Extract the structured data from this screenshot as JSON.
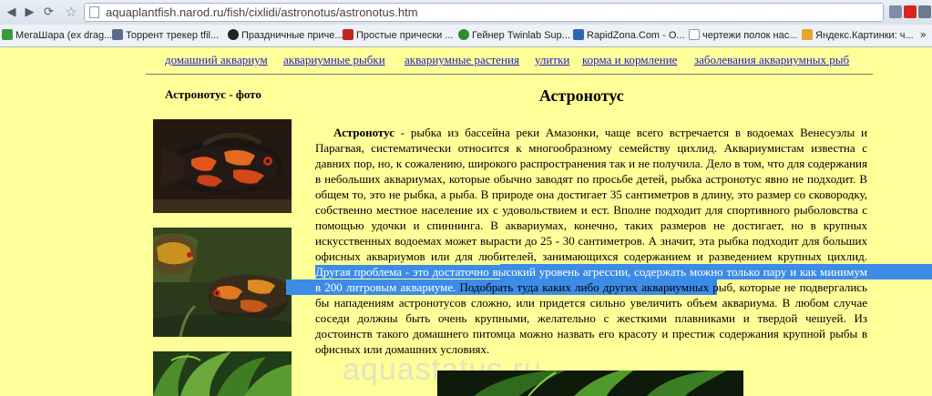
{
  "browser": {
    "back_glyph": "◀",
    "forward_glyph": "▶",
    "reload_glyph": "⟳",
    "star_glyph": "☆",
    "url": "aquaplantfish.narod.ru/fish/cixlidi/astronotus/astronotus.htm",
    "bookmarks": [
      {
        "label": "МегаШара (ex drag...",
        "icon": "green-check-icon",
        "color": "#3b9b3b"
      },
      {
        "label": "Торрент трекер tfil...",
        "icon": "tracker-icon",
        "color": "#5a6b8c"
      },
      {
        "label": "Праздничные приче...",
        "icon": "eye-icon",
        "color": "#222222"
      },
      {
        "label": "Простые прически ...",
        "icon": "news-icon",
        "color": "#c4261d"
      },
      {
        "label": "Гейнер Twinlab Sup...",
        "icon": "circle-icon",
        "color": "#2e8b2e"
      },
      {
        "label": "RapidZona.Com - О...",
        "icon": "pin-icon",
        "color": "#2f66b3"
      },
      {
        "label": "чертежи полок нас...",
        "icon": "document-icon",
        "color": "#ffffff"
      },
      {
        "label": "Яндекс.Картинки: ч...",
        "icon": "folder-icon",
        "color": "#e6a82a"
      }
    ],
    "more_glyph": "»"
  },
  "nav": {
    "links": [
      "домашний аквариум",
      "аквариумные рыбки",
      "аквариумные растения",
      "улитки",
      "корма и кормление",
      "заболевания аквариумных рыб"
    ]
  },
  "sidebar": {
    "title": "Астронотус - фото"
  },
  "article": {
    "title": "Астронотус",
    "lead_bold": "Астронотус",
    "text_before": " - рыбка из бассейна реки Амазонки, чаще всего встречается в водоемах Венесуэлы и Парагвая, систематически относится к многообразному семейству цихлид. Аквариумистам известна с давних пор, но, к сожалению, широкого распространения так и не получила. Дело в том, что для содержания в небольших аквариумах, которые обычно заводят по просьбе детей, рыбка астронотус явно не подходит. В общем то, это не рыбка, а рыба. В природе она достигает 35 сантиметров в длину, это размер со сковородку, собственно местное население их с удовольствием и ест. Вполне подходит для спортивного рыболовства с помощью удочки и спиннинга. В аквариумах, конечно, таких размеров не достигает, но в крупных искусственных водоемах может вырасти до 25 - 30 сантиметров. А значит, эта рыбка подходит для больших офисных аквариумов или для любителей, занимающихся содержанием и разведением крупных цихлид. ",
    "text_highlight": "Другая проблема  - это достаточно высокий уровень агрессии, содержать можно только пару и как минимум в 200 литровым аквариуме.",
    "text_after": " Подобрать туда каких либо других аквариумных рыб, которые не подвергались бы нападениям астронотусов сложно, или придется сильно увеличить объем аквариума. В любом случае соседи должны быть очень крупными, желательно с жесткими плавниками и твердой чешуей. Из достоинств такого домашнего питомца можно назвать его красоту и престиж содержания крупной рыбы в офисных или домашних условиях."
  },
  "watermark": "aquastatus.ru",
  "colors": {
    "page_bg": "#ffff99",
    "link": "#1c1cd0",
    "selection": "#3c8ce7"
  }
}
